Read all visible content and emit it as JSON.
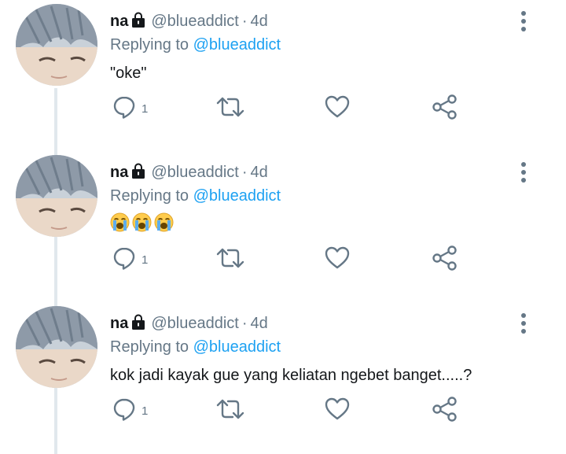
{
  "tweets": [
    {
      "name": "na",
      "handle": "@blueaddict",
      "separator": "·",
      "time": "4d",
      "replying_prefix": "Replying to",
      "replying_handle": "@blueaddict",
      "text": "\"oke\"",
      "reply_count": "1"
    },
    {
      "name": "na",
      "handle": "@blueaddict",
      "separator": "·",
      "time": "4d",
      "replying_prefix": "Replying to",
      "replying_handle": "@blueaddict",
      "emojis": [
        "loudly-crying-face",
        "loudly-crying-face",
        "loudly-crying-face"
      ],
      "reply_count": "1"
    },
    {
      "name": "na",
      "handle": "@blueaddict",
      "separator": "·",
      "time": "4d",
      "replying_prefix": "Replying to",
      "replying_handle": "@blueaddict",
      "text": "kok jadi kayak gue yang keliatan ngebet banget.....?",
      "reply_count": "1"
    }
  ],
  "icons": {
    "lock": "lock-icon",
    "reply": "reply-icon",
    "retweet": "retweet-icon",
    "like": "heart-icon",
    "share": "share-icon",
    "menu": "more-vertical-icon"
  },
  "colors": {
    "link": "#1da1f2",
    "secondary_text": "#657786",
    "primary_text": "#14171a",
    "thread_line": "#e1e8ed"
  }
}
